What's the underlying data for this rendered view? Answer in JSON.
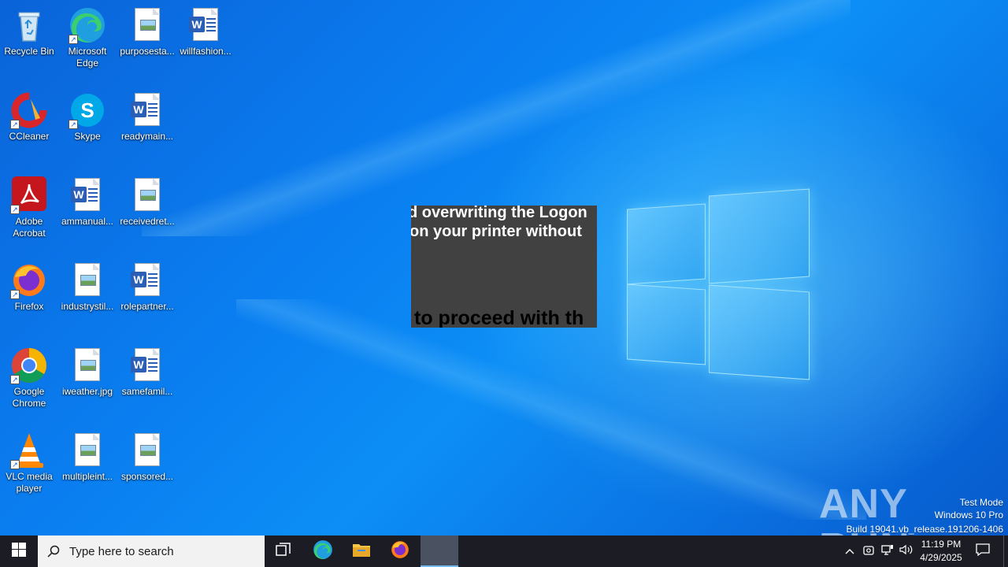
{
  "desktop": {
    "icons": [
      {
        "label": "Recycle Bin"
      },
      {
        "label": "Microsoft Edge"
      },
      {
        "label": "purposesta..."
      },
      {
        "label": "willfashion..."
      },
      {
        "label": "CCleaner"
      },
      {
        "label": "Skype"
      },
      {
        "label": "readymain..."
      },
      {
        "label": "Adobe Acrobat"
      },
      {
        "label": "ammanual..."
      },
      {
        "label": "receivedret..."
      },
      {
        "label": "Firefox"
      },
      {
        "label": "industrystil..."
      },
      {
        "label": "rolepartner..."
      },
      {
        "label": "Google Chrome"
      },
      {
        "label": "iweather.jpg"
      },
      {
        "label": "samefamil..."
      },
      {
        "label": "VLC media player"
      },
      {
        "label": "multipleint..."
      },
      {
        "label": "sponsored..."
      }
    ]
  },
  "overlay": {
    "line1": "d overwriting the Logon",
    "line2": "on your printer without",
    "line3": "to proceed with th"
  },
  "watermark": {
    "brand": "ANY RUN",
    "mode": "Test Mode",
    "edition": "Windows 10 Pro",
    "build": "Build 19041.vb_release.191206-1406"
  },
  "taskbar": {
    "search_placeholder": "Type here to search",
    "time": "11:19 PM",
    "date": "4/29/2025"
  }
}
